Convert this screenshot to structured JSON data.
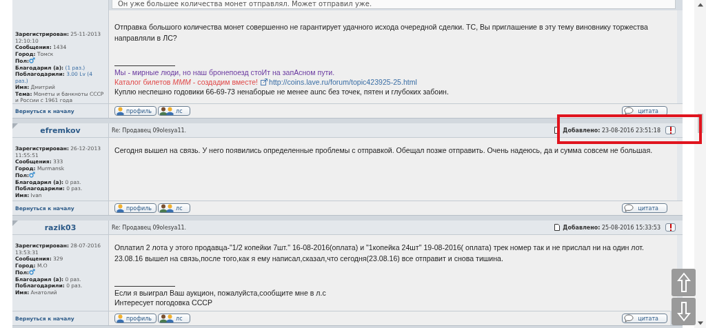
{
  "top_quote": "Он уже большее количества монет отправлял. Может отправил уже.",
  "posts": [
    {
      "highlighted": false,
      "profile": [
        {
          "label": "Зарегистрирован:",
          "value": "25-11-2013 12:10:10",
          "kind": "text"
        },
        {
          "label": "Сообщения:",
          "value": "1434",
          "kind": "text"
        },
        {
          "label": "Город:",
          "value": "Томск",
          "kind": "text"
        },
        {
          "label": "Пол:",
          "kind": "gender"
        },
        {
          "label": "Благодарил (а):",
          "value": "(1 раз.)",
          "kind": "link"
        },
        {
          "label": "Поблагодарили:",
          "value": "3.00 Lv",
          "extra": "(4 раз.)",
          "kind": "link"
        },
        {
          "label": "Имя:",
          "value": "Дмитрий",
          "kind": "text"
        },
        {
          "label": "Тема:",
          "value": "Монеты и банкноты СССР и России с 1961 года",
          "kind": "text"
        }
      ],
      "body": [
        "Отправка большого количества монет совершенно не гарантирует удачного исхода очередной сделки. ТС, Вы приглашение в эту тему виновнику торжества направляли в ЛС?"
      ],
      "signature": [
        {
          "kind": "tagline",
          "text": "Мы - мирные люди, но наш бронепоезд стоИт на запАсном пути."
        },
        {
          "kind": "promo",
          "text": "Каталог билетов *МММ* - создадим вместе!",
          "url": "http://coins.lave.ru/forum/topic423925-25.html"
        },
        {
          "kind": "plain",
          "text": "Куплю неспешно годовики 66-69-73 ненаборые не менее aunc без точек, пятен и глубоких забоин."
        }
      ],
      "back_link": "Вернуться к началу",
      "profile_button": "профиль",
      "pm_button": "лс",
      "quote_button": "цитата"
    },
    {
      "author": "efremkov",
      "subject": "Re: Продавец 09olesya11.",
      "added_label": "Добавлено:",
      "added_time": "23-08-2016 23:51:18",
      "highlighted": true,
      "profile": [
        {
          "label": "Зарегистрирован:",
          "value": "26-12-2013 11:55:51",
          "kind": "text"
        },
        {
          "label": "Сообщения:",
          "value": "333",
          "kind": "text"
        },
        {
          "label": "Город:",
          "value": "Murmansk",
          "kind": "text"
        },
        {
          "label": "Пол:",
          "kind": "gender"
        },
        {
          "label": "Благодарил (а):",
          "value": "0 раз.",
          "kind": "text"
        },
        {
          "label": "Поблагодарили:",
          "value": "0 раз.",
          "kind": "text"
        },
        {
          "label": "Имя:",
          "value": "Ivan",
          "kind": "text"
        }
      ],
      "body": [
        "Сегодня вышел на связь. У него появились определенные проблемы с отправкой. Обещал позже отправить. Очень надеюсь, да и сумма совсем не большая."
      ],
      "back_link": "Вернуться к началу",
      "profile_button": "профиль",
      "pm_button": "лс",
      "quote_button": "цитата"
    },
    {
      "author": "razik03",
      "subject": "Re: Продавец 09olesya11.",
      "added_label": "Добавлено:",
      "added_time": "25-08-2016 15:33:53",
      "highlighted": false,
      "profile": [
        {
          "label": "Зарегистрирован:",
          "value": "28-07-2016 13:53:31",
          "kind": "text"
        },
        {
          "label": "Сообщения:",
          "value": "329",
          "kind": "text"
        },
        {
          "label": "Город:",
          "value": "М.О",
          "kind": "text"
        },
        {
          "label": "Пол:",
          "kind": "gender"
        },
        {
          "label": "Благодарил (а):",
          "value": "0 раз.",
          "kind": "text"
        },
        {
          "label": "Поблагодарили:",
          "value": "0 раз.",
          "kind": "text"
        },
        {
          "label": "Имя:",
          "value": "Анатолий",
          "kind": "text"
        }
      ],
      "body": [
        "Оплатил 2 лота у этого продавца-\"1/2 копейки 7шт.\" 16-08-2016(оплата) и \"1копейка 24шт\" 19-08-2016( оплата) трек номер так и не прислал ни на один лот. 23.08.16 вышел на связь,после того,как я ему написал,сказал,что сегодня(23.08.16) все отправит и снова тишина."
      ],
      "signature": [
        {
          "kind": "plain",
          "text": "Если я выиграл Ваш аукцион, пожалуйста,сообщите мне в л.с"
        },
        {
          "kind": "plain",
          "text": "Интересует погодовка СССР"
        }
      ],
      "back_link": "Вернуться к началу",
      "profile_button": "профиль",
      "pm_button": "лс",
      "quote_button": "цитата"
    }
  ]
}
